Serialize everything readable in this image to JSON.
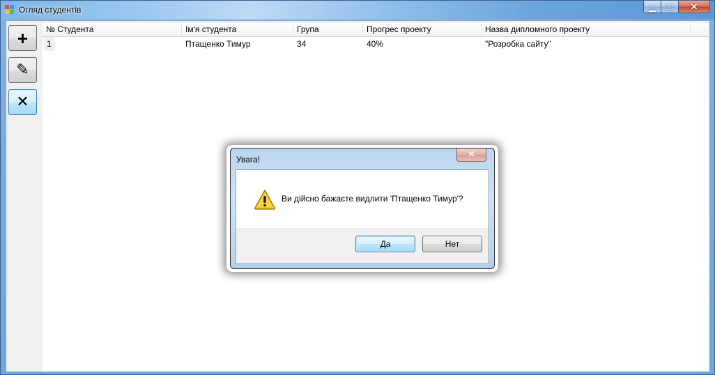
{
  "window": {
    "title": "Огляд студентів",
    "minimize_glyph": "▁",
    "maximize_glyph": "□",
    "close_glyph": "✕"
  },
  "toolbar": {
    "add_glyph": "+",
    "edit_glyph": "✎",
    "delete_glyph": "✕",
    "icons": [
      "plus-icon",
      "pencil-icon",
      "x-icon"
    ]
  },
  "grid": {
    "columns": [
      "№ Студента",
      "Ім'я студента",
      "Група",
      "Прогрес проекту",
      "Назва дипломного проекту"
    ],
    "rows": [
      [
        "1",
        "Птащенко Тимур",
        "34",
        "40%",
        "\"Розробка сайту\""
      ]
    ]
  },
  "dialog": {
    "title": "Увага!",
    "message": "Ви дійсно бажаєте видлити 'Птащенко Тимур'?",
    "yes_label": "Да",
    "no_label": "Нет",
    "close_glyph": "✕",
    "icon": "warning-icon"
  },
  "colors": {
    "title_bar": "#8fbde9",
    "close_button": "#c2432b",
    "focused_button": "#3c7fb1"
  }
}
